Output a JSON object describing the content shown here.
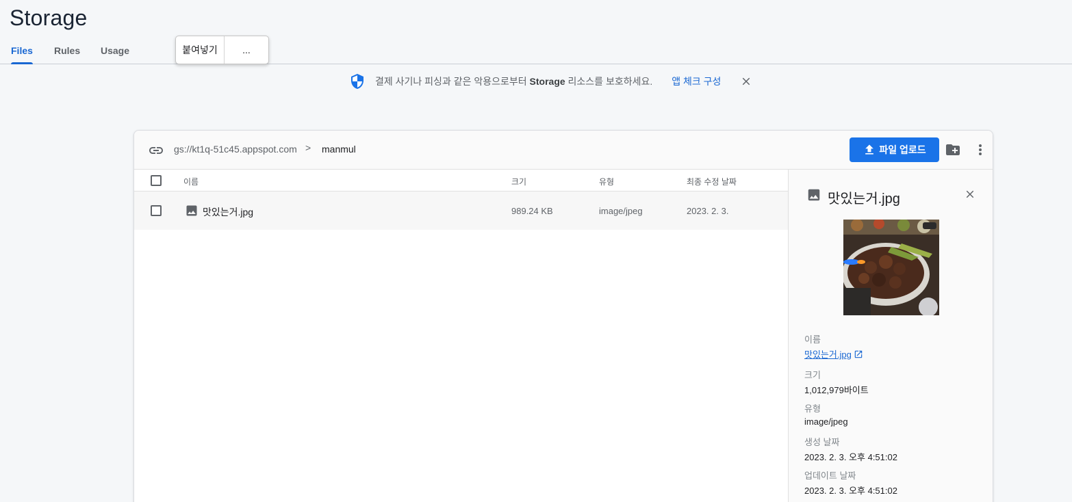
{
  "page": {
    "title": "Storage"
  },
  "tabs": [
    {
      "label": "Files",
      "active": true
    },
    {
      "label": "Rules",
      "active": false
    },
    {
      "label": "Usage",
      "active": false
    }
  ],
  "context_popup": {
    "paste": "붙여넣기",
    "more": "..."
  },
  "banner": {
    "text_prefix": "결제 사기나 피싱과 같은 악용으로부터 ",
    "text_bold": "Storage",
    "text_suffix": " 리소스를 보호하세요.",
    "link": "앱 체크 구성",
    "icon": "shield-icon"
  },
  "browser": {
    "bucket": "gs://kt1q-51c45.appspot.com",
    "separator": ">",
    "folder": "manmul",
    "upload_label": "파일 업로드",
    "columns": {
      "name": "이름",
      "size": "크기",
      "type": "유형",
      "modified": "최종 수정 날짜"
    },
    "rows": [
      {
        "name": "맛있는거.jpg",
        "size": "989.24 KB",
        "type": "image/jpeg",
        "modified": "2023. 2. 3."
      }
    ]
  },
  "detail": {
    "title": "맛있는거.jpg",
    "fields": {
      "name_label": "이름",
      "name_value": "맛있는거.jpg",
      "size_label": "크기",
      "size_value": "1,012,979바이트",
      "type_label": "유형",
      "type_value": "image/jpeg",
      "created_label": "생성 날짜",
      "created_value": "2023. 2. 3. 오후 4:51:02",
      "updated_label": "업데이트 날짜",
      "updated_value": "2023. 2. 3. 오후 4:51:02"
    }
  },
  "colors": {
    "accent": "#1a73e8",
    "link": "#1967d2",
    "background": "#f5f7f9"
  }
}
